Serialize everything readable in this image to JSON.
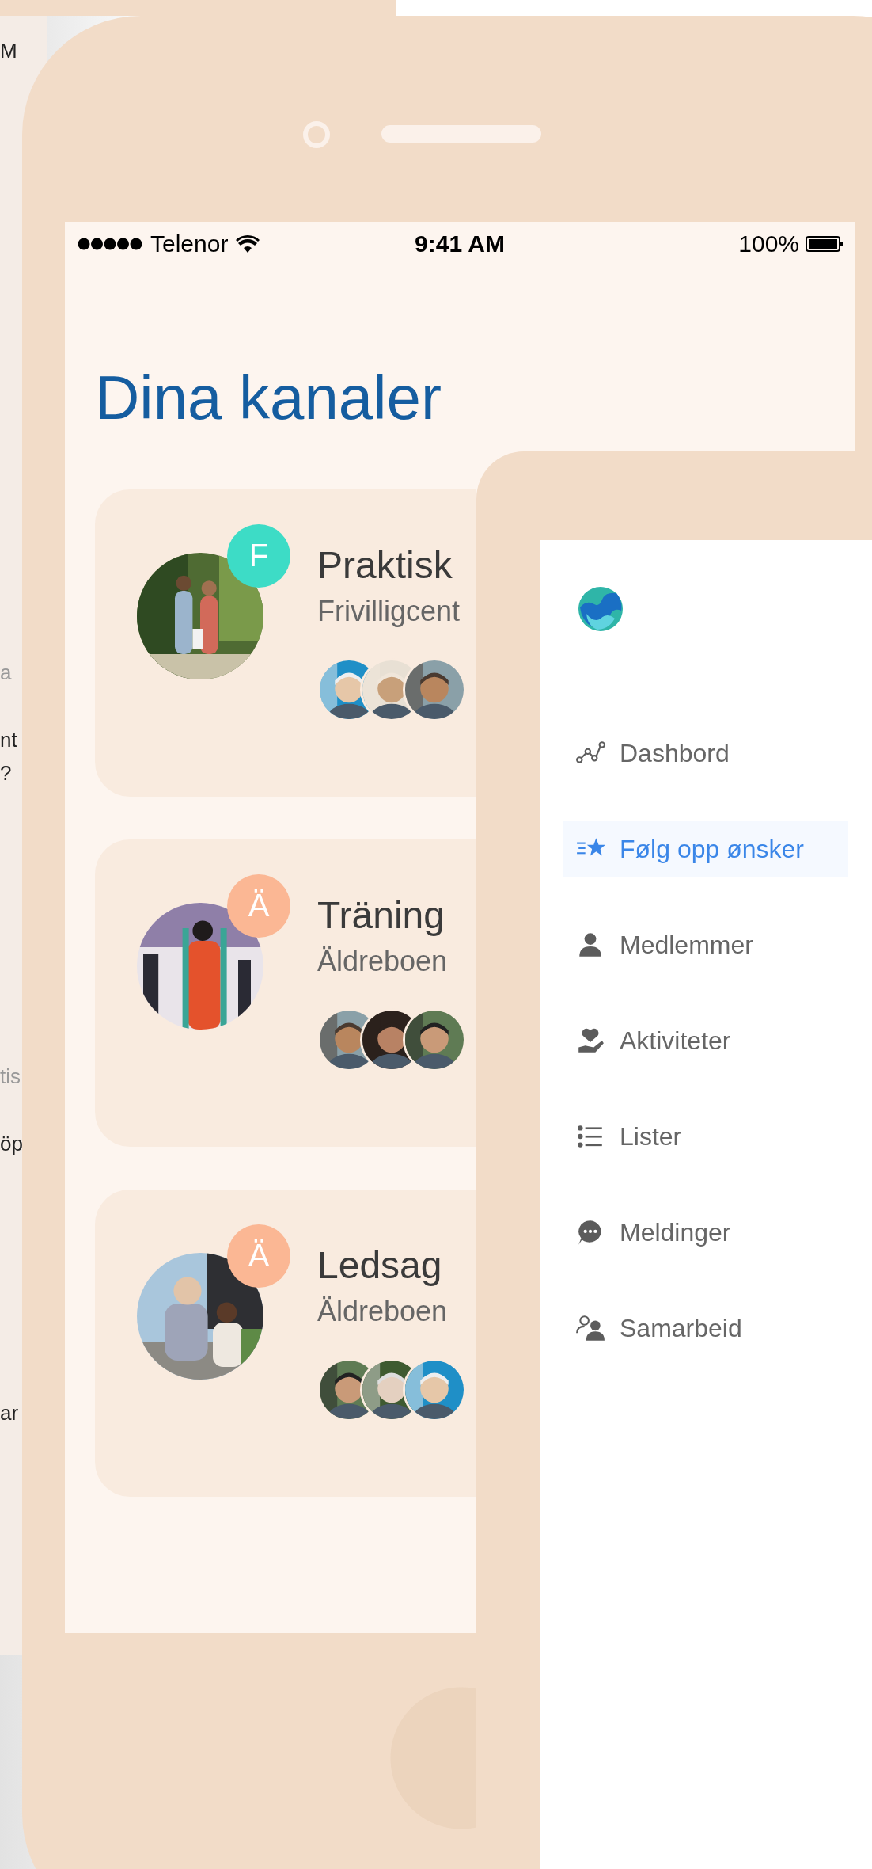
{
  "back_screen": {
    "fragments": [
      {
        "text": "M",
        "muted": false
      },
      {
        "text": "a",
        "muted": true
      },
      {
        "text": "nt",
        "muted": false
      },
      {
        "text": "?",
        "muted": false
      },
      {
        "text": "tis",
        "muted": true
      },
      {
        "text": "öp",
        "muted": false
      },
      {
        "text": "ar",
        "muted": false
      }
    ]
  },
  "status_bar": {
    "carrier": "Telenor",
    "time": "9:41 AM",
    "battery": "100%"
  },
  "title": "Dina kanaler",
  "channels": [
    {
      "name": "Praktisk",
      "organisation": "Frivilligcent",
      "badge": "F",
      "color": "#3ddcc6"
    },
    {
      "name": "Träning",
      "organisation": "Äldreboen",
      "badge": "Ä",
      "color": "#fbb794"
    },
    {
      "name": "Ledsag",
      "organisation": "Äldreboen",
      "badge": "Ä",
      "color": "#fbb794"
    }
  ],
  "sidebar": {
    "items": [
      {
        "label": "Dashbord",
        "selected": false
      },
      {
        "label": "Følg opp ønsker",
        "selected": true
      },
      {
        "label": "Medlemmer",
        "selected": false
      },
      {
        "label": "Aktiviteter",
        "selected": false
      },
      {
        "label": "Lister",
        "selected": false
      },
      {
        "label": "Meldinger",
        "selected": false
      },
      {
        "label": "Samarbeid",
        "selected": false
      }
    ]
  }
}
